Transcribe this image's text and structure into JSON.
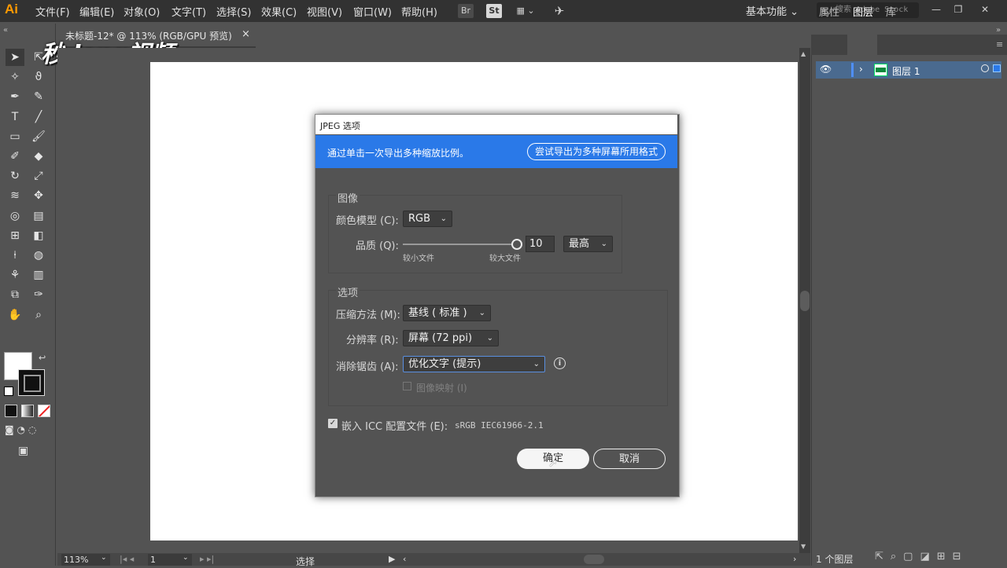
{
  "app": {
    "logo": "Ai"
  },
  "menubar": {
    "items": [
      "文件(F)",
      "编辑(E)",
      "对象(O)",
      "文字(T)",
      "选择(S)",
      "效果(C)",
      "视图(V)",
      "窗口(W)",
      "帮助(H)"
    ],
    "br": "Br",
    "st": "St",
    "workspace": "基本功能 ⌄",
    "search_placeholder": "搜索 Adobe Stock"
  },
  "document": {
    "tab_title": "未标题-12* @ 113% (RGB/GPU 预览)",
    "close": "×"
  },
  "watermark": "秒dong视频",
  "panel": {
    "tabs": [
      "属性",
      "图层",
      "库"
    ],
    "layer_name": "图层 1",
    "footer_count": "1 个图层"
  },
  "statusbar": {
    "zoom": "113%",
    "artboard": "1",
    "tool": "选择"
  },
  "dialog": {
    "title": "JPEG 选项",
    "banner_text": "通过单击一次导出多种缩放比例。",
    "banner_button": "尝试导出为多种屏幕所用格式",
    "image_section": "图像",
    "color_model_label": "颜色模型 (C):",
    "color_model_value": "RGB",
    "quality_label": "品质 (Q):",
    "quality_value": "10",
    "quality_preset": "最高",
    "quality_min_label": "较小文件",
    "quality_max_label": "较大文件",
    "quality_fraction": 1.0,
    "options_section": "选项",
    "compression_label": "压缩方法 (M):",
    "compression_value": "基线 ( 标准 )",
    "resolution_label": "分辨率 (R):",
    "resolution_value": "屏幕 (72 ppi)",
    "antialias_label": "消除锯齿 (A):",
    "antialias_value": "优化文字 (提示)",
    "imagemap_label": "图像映射 (I)",
    "icc_label": "嵌入 ICC 配置文件 (E):",
    "icc_value": "sRGB IEC61966-2.1",
    "ok": "确定",
    "cancel": "取消"
  },
  "colors": {
    "accent": "#2a79e8",
    "layer_selected": "#4a6a8f",
    "logo": "#ff9a00"
  }
}
